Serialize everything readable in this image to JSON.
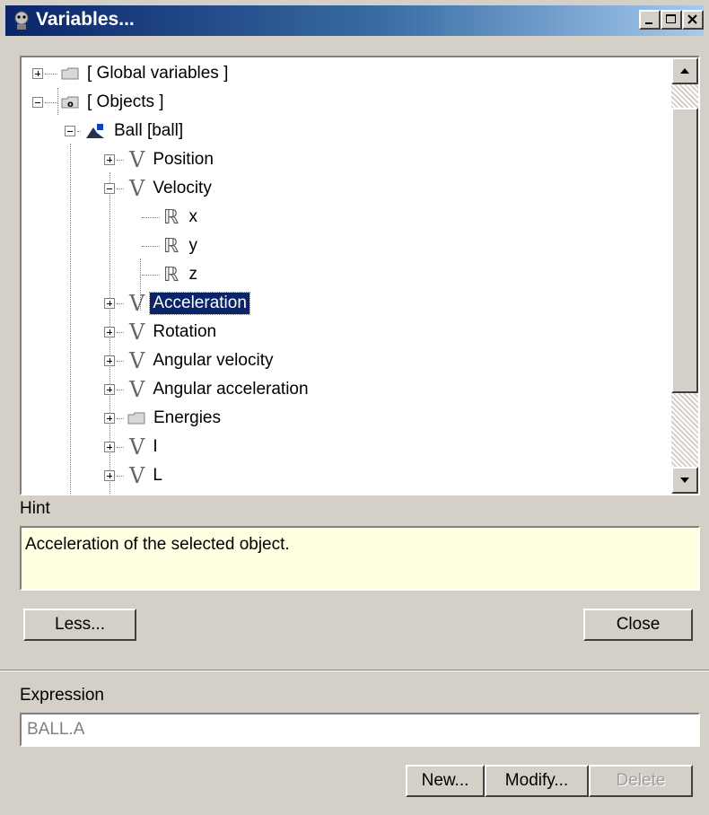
{
  "window": {
    "title": "Variables..."
  },
  "tree": {
    "rows": [
      {
        "label": "[ Global variables ]",
        "icon": "folder-icon",
        "expander": "plus"
      },
      {
        "label": "[ Objects ]",
        "icon": "objects-folder-icon",
        "expander": "minus"
      },
      {
        "label": "Ball  [ball]",
        "icon": "ball-object-icon",
        "expander": "minus"
      },
      {
        "label": "Position",
        "icon": "vector-icon",
        "expander": "plus"
      },
      {
        "label": "Velocity",
        "icon": "vector-icon",
        "expander": "minus"
      },
      {
        "label": "x",
        "icon": "real-icon"
      },
      {
        "label": "y",
        "icon": "real-icon"
      },
      {
        "label": "z",
        "icon": "real-icon"
      },
      {
        "label": "Acceleration",
        "icon": "vector-icon",
        "expander": "plus",
        "selected": true
      },
      {
        "label": "Rotation",
        "icon": "vector-icon",
        "expander": "plus"
      },
      {
        "label": "Angular velocity",
        "icon": "vector-icon",
        "expander": "plus"
      },
      {
        "label": "Angular acceleration",
        "icon": "vector-icon",
        "expander": "plus"
      },
      {
        "label": "Energies",
        "icon": "folder-icon",
        "expander": "plus"
      },
      {
        "label": "I",
        "icon": "vector-icon",
        "expander": "plus"
      },
      {
        "label": "L",
        "icon": "vector-icon",
        "expander": "plus"
      }
    ]
  },
  "hint": {
    "label": "Hint",
    "text": "Acceleration of the selected object."
  },
  "buttons": {
    "less": "Less...",
    "close": "Close",
    "new": "New...",
    "modify": "Modify...",
    "delete": "Delete"
  },
  "expression": {
    "label": "Expression",
    "value": "BALL.A"
  }
}
